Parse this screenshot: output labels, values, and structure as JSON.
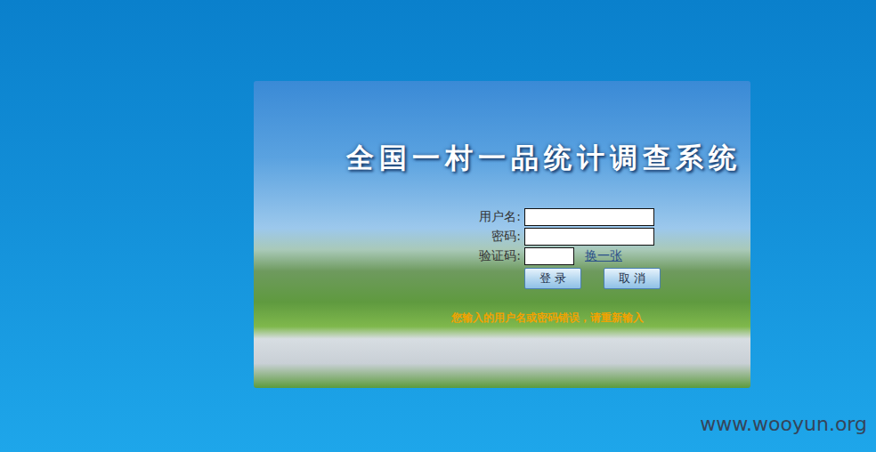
{
  "title": "全国一村一品统计调查系统",
  "form": {
    "fields": [
      {
        "kind": "text",
        "label": "用户名:",
        "value": "",
        "refresh_link": ""
      },
      {
        "kind": "password",
        "label": "密码:",
        "value": "",
        "refresh_link": ""
      },
      {
        "kind": "captcha",
        "label": "验证码:",
        "value": "",
        "refresh_link": "换一张"
      }
    ],
    "buttons": [
      "登 录",
      "取 消"
    ],
    "error": "您输入的用户名或密码错误，请重新输入"
  },
  "watermark": "www.wooyun.org"
}
